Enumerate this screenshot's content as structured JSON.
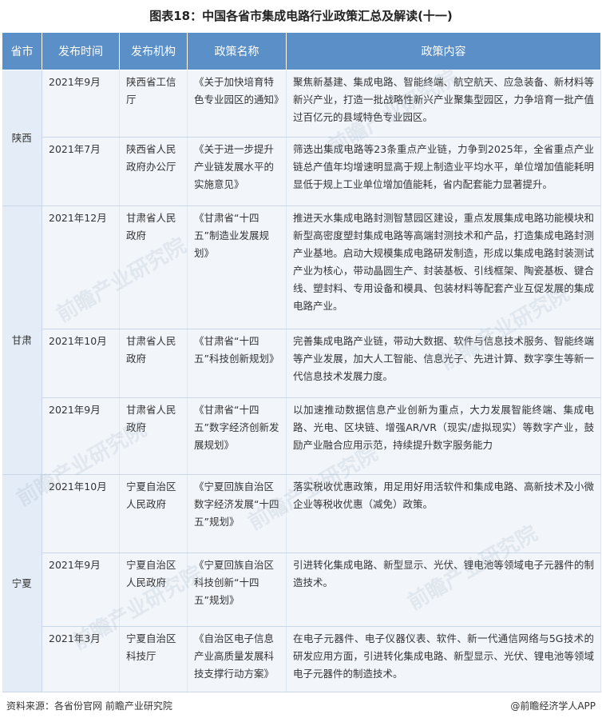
{
  "title": "图表18：中国各省市集成电路行业政策汇总及解读(十一)",
  "headers": [
    "省市",
    "发布时间",
    "发布机构",
    "政策名称",
    "政策内容"
  ],
  "groups": [
    {
      "province": "陕西",
      "rows": [
        {
          "date": "2021年9月",
          "org": "陕西省工信厅",
          "name": "《关于加快培育特色专业园区的通知》",
          "content": "聚焦新基建、集成电路、智能终端、航空航天、应急装备、新材料等新兴产业，打造一批战略性新兴产业聚集型园区，力争培育一批产值过百亿元的县域特色专业园区。"
        },
        {
          "date": "2021年7月",
          "org": "陕西省人民政府办公厅",
          "name": "《关于进一步提升产业链发展水平的实施意见》",
          "content": "筛选出集成电路等23条重点产业链，力争到2025年，全省重点产业链总产值年均增速明显高于规上制造业平均水平，单位增加值能耗明显低于规上工业单位增加值能耗，省内配套能力显著提升。"
        }
      ]
    },
    {
      "province": "甘肃",
      "rows": [
        {
          "date": "2021年12月",
          "org": "甘肃省人民政府",
          "name": "《甘肃省“十四五”制造业发展规划》",
          "content": "推进天水集成电路封测智慧园区建设，重点发展集成电路功能模块和新型高密度塑封集成电路等高端封测技术和产品，打造集成电路封测产业基地。启动大规模集成电路研发制造，形成以集成电路封装测试产业为核心，带动晶圆生产、封装基板、引线框架、陶瓷基板、键合线、塑封料、专用设备和模具、包装材料等配套产业互促发展的集成电路产业。"
        },
        {
          "date": "2021年10月",
          "org": "甘肃省人民政府",
          "name": "《甘肃省“十四五”科技创新规划》",
          "content": "完善集成电路产业链，带动大数据、软件与信息技术服务、智能终端等产业发展，加大人工智能、信息光子、先进计算、数字孪生等新一代信息技术发展力度。"
        },
        {
          "date": "2021年9月",
          "org": "甘肃省人民政府",
          "name": "《甘肃省“十四五”数字经济创新发展规划》",
          "content": "以加速推动数据信息产业创新为重点，大力发展智能终端、集成电路、光电、区块链、增强AR/VR（现实/虚拟现实）等数字产业，鼓励产业融合应用示范，持续提升数字服务能力"
        }
      ]
    },
    {
      "province": "宁夏",
      "rows": [
        {
          "date": "2021年10月",
          "org": "宁夏自治区人民政府",
          "name": "《宁夏回族自治区数字经济发展“十四五”规划》",
          "content": "落实税收优惠政策，用足用好用活软件和集成电路、高新技术及小微企业等税收优惠（减免）政策。"
        },
        {
          "date": "2021年9月",
          "org": "宁夏自治区人民政府",
          "name": "《宁夏回族自治区科技创新“十四五”规划》",
          "content": "引进转化集成电路、新型显示、光伏、锂电池等领域电子元器件的制造技术。"
        },
        {
          "date": "2021年3月",
          "org": "宁夏自治区科技厅",
          "name": "《自治区电子信息产业高质量发展科技支撑行动方案》",
          "content": "在电子元器件、电子仪器仪表、软件、新一代通信网络与5G技术的研发应用方面，引进转化集成电路、新型显示、光伏、锂电池等领域电子元器件的制造技术。"
        }
      ]
    }
  ],
  "footer": {
    "source": "资料来源：各省份官网 前瞻产业研究院",
    "brand": "@前瞻经济学人APP"
  },
  "watermark": "前瞻产业研究院"
}
